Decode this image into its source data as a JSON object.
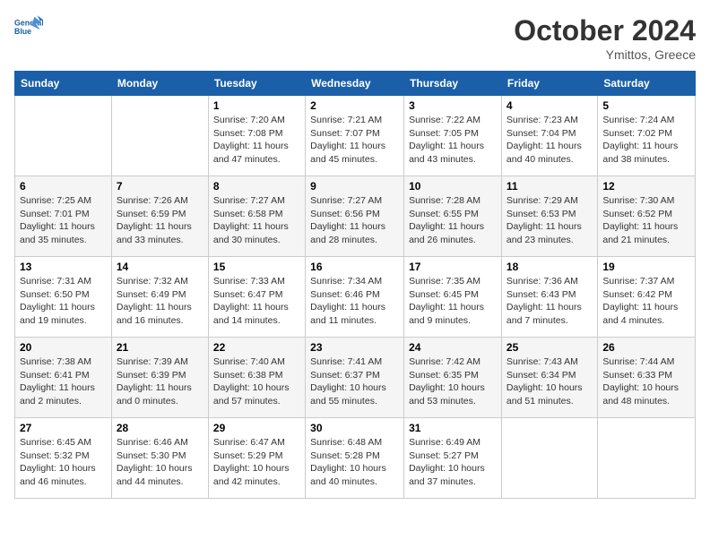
{
  "header": {
    "logo_line1": "General",
    "logo_line2": "Blue",
    "month_title": "October 2024",
    "subtitle": "Ymittos, Greece"
  },
  "days_of_week": [
    "Sunday",
    "Monday",
    "Tuesday",
    "Wednesday",
    "Thursday",
    "Friday",
    "Saturday"
  ],
  "weeks": [
    [
      {
        "day": "",
        "sunrise": "",
        "sunset": "",
        "daylight": ""
      },
      {
        "day": "",
        "sunrise": "",
        "sunset": "",
        "daylight": ""
      },
      {
        "day": "1",
        "sunrise": "Sunrise: 7:20 AM",
        "sunset": "Sunset: 7:08 PM",
        "daylight": "Daylight: 11 hours and 47 minutes."
      },
      {
        "day": "2",
        "sunrise": "Sunrise: 7:21 AM",
        "sunset": "Sunset: 7:07 PM",
        "daylight": "Daylight: 11 hours and 45 minutes."
      },
      {
        "day": "3",
        "sunrise": "Sunrise: 7:22 AM",
        "sunset": "Sunset: 7:05 PM",
        "daylight": "Daylight: 11 hours and 43 minutes."
      },
      {
        "day": "4",
        "sunrise": "Sunrise: 7:23 AM",
        "sunset": "Sunset: 7:04 PM",
        "daylight": "Daylight: 11 hours and 40 minutes."
      },
      {
        "day": "5",
        "sunrise": "Sunrise: 7:24 AM",
        "sunset": "Sunset: 7:02 PM",
        "daylight": "Daylight: 11 hours and 38 minutes."
      }
    ],
    [
      {
        "day": "6",
        "sunrise": "Sunrise: 7:25 AM",
        "sunset": "Sunset: 7:01 PM",
        "daylight": "Daylight: 11 hours and 35 minutes."
      },
      {
        "day": "7",
        "sunrise": "Sunrise: 7:26 AM",
        "sunset": "Sunset: 6:59 PM",
        "daylight": "Daylight: 11 hours and 33 minutes."
      },
      {
        "day": "8",
        "sunrise": "Sunrise: 7:27 AM",
        "sunset": "Sunset: 6:58 PM",
        "daylight": "Daylight: 11 hours and 30 minutes."
      },
      {
        "day": "9",
        "sunrise": "Sunrise: 7:27 AM",
        "sunset": "Sunset: 6:56 PM",
        "daylight": "Daylight: 11 hours and 28 minutes."
      },
      {
        "day": "10",
        "sunrise": "Sunrise: 7:28 AM",
        "sunset": "Sunset: 6:55 PM",
        "daylight": "Daylight: 11 hours and 26 minutes."
      },
      {
        "day": "11",
        "sunrise": "Sunrise: 7:29 AM",
        "sunset": "Sunset: 6:53 PM",
        "daylight": "Daylight: 11 hours and 23 minutes."
      },
      {
        "day": "12",
        "sunrise": "Sunrise: 7:30 AM",
        "sunset": "Sunset: 6:52 PM",
        "daylight": "Daylight: 11 hours and 21 minutes."
      }
    ],
    [
      {
        "day": "13",
        "sunrise": "Sunrise: 7:31 AM",
        "sunset": "Sunset: 6:50 PM",
        "daylight": "Daylight: 11 hours and 19 minutes."
      },
      {
        "day": "14",
        "sunrise": "Sunrise: 7:32 AM",
        "sunset": "Sunset: 6:49 PM",
        "daylight": "Daylight: 11 hours and 16 minutes."
      },
      {
        "day": "15",
        "sunrise": "Sunrise: 7:33 AM",
        "sunset": "Sunset: 6:47 PM",
        "daylight": "Daylight: 11 hours and 14 minutes."
      },
      {
        "day": "16",
        "sunrise": "Sunrise: 7:34 AM",
        "sunset": "Sunset: 6:46 PM",
        "daylight": "Daylight: 11 hours and 11 minutes."
      },
      {
        "day": "17",
        "sunrise": "Sunrise: 7:35 AM",
        "sunset": "Sunset: 6:45 PM",
        "daylight": "Daylight: 11 hours and 9 minutes."
      },
      {
        "day": "18",
        "sunrise": "Sunrise: 7:36 AM",
        "sunset": "Sunset: 6:43 PM",
        "daylight": "Daylight: 11 hours and 7 minutes."
      },
      {
        "day": "19",
        "sunrise": "Sunrise: 7:37 AM",
        "sunset": "Sunset: 6:42 PM",
        "daylight": "Daylight: 11 hours and 4 minutes."
      }
    ],
    [
      {
        "day": "20",
        "sunrise": "Sunrise: 7:38 AM",
        "sunset": "Sunset: 6:41 PM",
        "daylight": "Daylight: 11 hours and 2 minutes."
      },
      {
        "day": "21",
        "sunrise": "Sunrise: 7:39 AM",
        "sunset": "Sunset: 6:39 PM",
        "daylight": "Daylight: 11 hours and 0 minutes."
      },
      {
        "day": "22",
        "sunrise": "Sunrise: 7:40 AM",
        "sunset": "Sunset: 6:38 PM",
        "daylight": "Daylight: 10 hours and 57 minutes."
      },
      {
        "day": "23",
        "sunrise": "Sunrise: 7:41 AM",
        "sunset": "Sunset: 6:37 PM",
        "daylight": "Daylight: 10 hours and 55 minutes."
      },
      {
        "day": "24",
        "sunrise": "Sunrise: 7:42 AM",
        "sunset": "Sunset: 6:35 PM",
        "daylight": "Daylight: 10 hours and 53 minutes."
      },
      {
        "day": "25",
        "sunrise": "Sunrise: 7:43 AM",
        "sunset": "Sunset: 6:34 PM",
        "daylight": "Daylight: 10 hours and 51 minutes."
      },
      {
        "day": "26",
        "sunrise": "Sunrise: 7:44 AM",
        "sunset": "Sunset: 6:33 PM",
        "daylight": "Daylight: 10 hours and 48 minutes."
      }
    ],
    [
      {
        "day": "27",
        "sunrise": "Sunrise: 6:45 AM",
        "sunset": "Sunset: 5:32 PM",
        "daylight": "Daylight: 10 hours and 46 minutes."
      },
      {
        "day": "28",
        "sunrise": "Sunrise: 6:46 AM",
        "sunset": "Sunset: 5:30 PM",
        "daylight": "Daylight: 10 hours and 44 minutes."
      },
      {
        "day": "29",
        "sunrise": "Sunrise: 6:47 AM",
        "sunset": "Sunset: 5:29 PM",
        "daylight": "Daylight: 10 hours and 42 minutes."
      },
      {
        "day": "30",
        "sunrise": "Sunrise: 6:48 AM",
        "sunset": "Sunset: 5:28 PM",
        "daylight": "Daylight: 10 hours and 40 minutes."
      },
      {
        "day": "31",
        "sunrise": "Sunrise: 6:49 AM",
        "sunset": "Sunset: 5:27 PM",
        "daylight": "Daylight: 10 hours and 37 minutes."
      },
      {
        "day": "",
        "sunrise": "",
        "sunset": "",
        "daylight": ""
      },
      {
        "day": "",
        "sunrise": "",
        "sunset": "",
        "daylight": ""
      }
    ]
  ]
}
